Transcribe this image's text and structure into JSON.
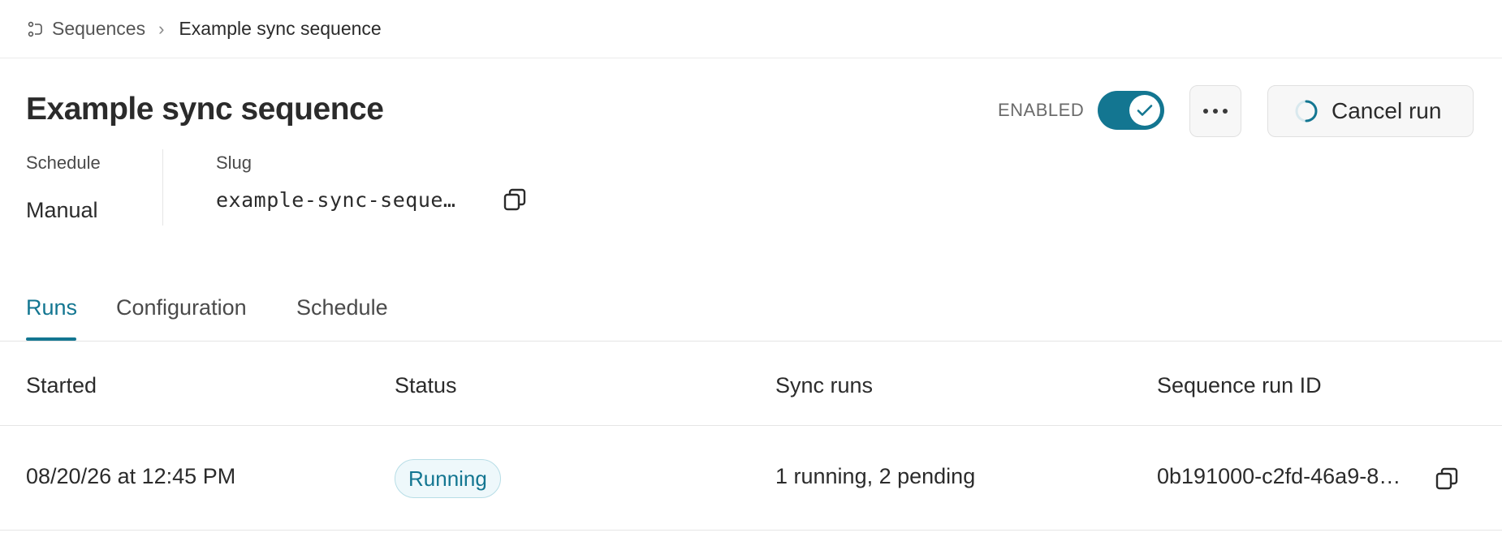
{
  "breadcrumb": {
    "icon": "sequence-icon",
    "parent_label": "Sequences",
    "current_label": "Example sync sequence"
  },
  "header": {
    "title": "Example sync sequence",
    "enabled_label": "ENABLED",
    "enabled": true,
    "cancel_label": "Cancel run"
  },
  "meta": {
    "schedule_label": "Schedule",
    "schedule_value": "Manual",
    "slug_label": "Slug",
    "slug_value": "example-sync-seque…"
  },
  "tabs": [
    {
      "label": "Runs",
      "active": true
    },
    {
      "label": "Configuration",
      "active": false
    },
    {
      "label": "Schedule",
      "active": false
    }
  ],
  "table": {
    "columns": [
      "Started",
      "Status",
      "Sync runs",
      "Sequence run ID"
    ],
    "rows": [
      {
        "started": "08/20/26 at 12:45 PM",
        "status": "Running",
        "sync_runs": "1 running, 2 pending",
        "run_id": "0b191000-c2fd-46a9-8…"
      }
    ]
  },
  "colors": {
    "accent": "#137691",
    "badge_bg": "#eef8fb",
    "badge_border": "#b7dde6"
  }
}
